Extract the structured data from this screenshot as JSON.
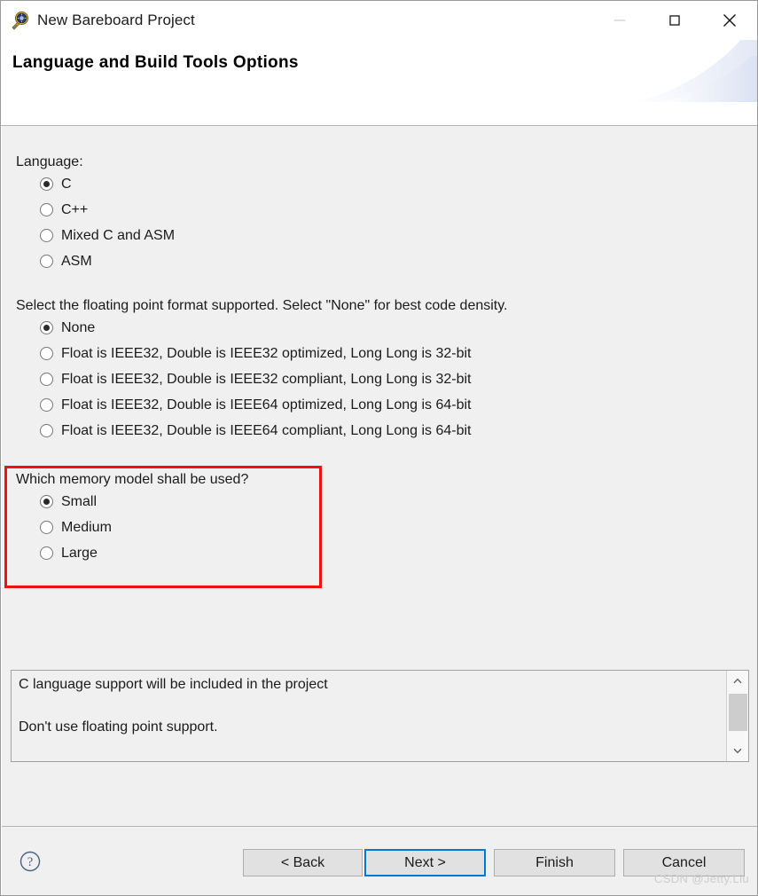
{
  "window": {
    "title": "New Bareboard Project",
    "icon": "bareboard-project-icon",
    "controls": {
      "minimize": "minimize-icon",
      "maximize": "maximize-icon",
      "close": "close-icon"
    }
  },
  "header": {
    "title": "Language and Build Tools Options"
  },
  "groups": [
    {
      "id": "language",
      "label": "Language:",
      "options": [
        {
          "label": "C",
          "checked": true
        },
        {
          "label": "C++",
          "checked": false
        },
        {
          "label": "Mixed C and ASM",
          "checked": false
        },
        {
          "label": "ASM",
          "checked": false
        }
      ]
    },
    {
      "id": "floating-point",
      "label": "Select the floating point format supported. Select \"None\" for best code density.",
      "options": [
        {
          "label": "None",
          "checked": true
        },
        {
          "label": "Float is IEEE32, Double is IEEE32 optimized, Long Long is 32-bit",
          "checked": false
        },
        {
          "label": "Float is IEEE32, Double is IEEE32 compliant, Long Long is 32-bit",
          "checked": false
        },
        {
          "label": "Float is IEEE32, Double is IEEE64 optimized, Long Long is 64-bit",
          "checked": false
        },
        {
          "label": "Float is IEEE32, Double is IEEE64 compliant, Long Long is 64-bit",
          "checked": false
        }
      ]
    },
    {
      "id": "memory-model",
      "label": "Which memory model shall be used?",
      "options": [
        {
          "label": "Small",
          "checked": true
        },
        {
          "label": "Medium",
          "checked": false
        },
        {
          "label": "Large",
          "checked": false
        }
      ]
    }
  ],
  "annotation": {
    "color": "#ee1111",
    "target": "memory-model"
  },
  "description": {
    "line1": "C language support will be included in the project",
    "line2": "Don't use floating point support.",
    "scrollbar": {
      "up": "chevron-up-icon",
      "down": "chevron-down-icon"
    }
  },
  "footer": {
    "help": "help-icon",
    "buttons": [
      {
        "id": "back",
        "label": "< Back",
        "focused": false
      },
      {
        "id": "next",
        "label": "Next >",
        "focused": true
      },
      {
        "id": "finish",
        "label": "Finish",
        "focused": false
      },
      {
        "id": "cancel",
        "label": "Cancel",
        "focused": false
      }
    ]
  },
  "watermark": "CSDN @Jetty.Liu"
}
